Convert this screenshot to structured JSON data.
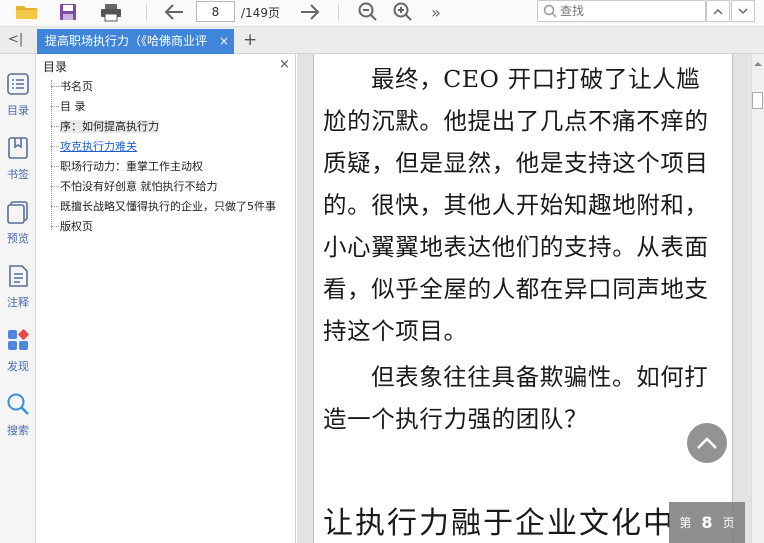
{
  "toolbar": {
    "current_page": "8",
    "total_pages": "/149页",
    "search_placeholder": "查找",
    "more_label": "»"
  },
  "tab": {
    "title": "提高职场执行力（《哈佛商业评",
    "close": "×",
    "new_tab": "+"
  },
  "rail": {
    "collapse": "<|",
    "items": [
      {
        "label": "目录",
        "icon": "toc-icon"
      },
      {
        "label": "书签",
        "icon": "bookmark-icon"
      },
      {
        "label": "预览",
        "icon": "preview-icon"
      },
      {
        "label": "注释",
        "icon": "note-icon"
      },
      {
        "label": "发现",
        "icon": "discover-icon"
      },
      {
        "label": "搜索",
        "icon": "search-icon"
      }
    ]
  },
  "toc": {
    "title": "目录",
    "close": "×",
    "items": [
      {
        "label": "书名页"
      },
      {
        "label": "目 录"
      },
      {
        "label": "序：如何提高执行力",
        "state": "selected"
      },
      {
        "label": "攻克执行力难关",
        "state": "link"
      },
      {
        "label": "职场行动力：重掌工作主动权"
      },
      {
        "label": "不怕没有好创意 就怕执行不给力"
      },
      {
        "label": "既擅长战略又懂得执行的企业，只做了5件事"
      },
      {
        "label": "版权页"
      }
    ]
  },
  "document": {
    "lines": [
      "最终，CEO 开口打破了让人尴",
      "尬的沉默。他提出了几点不痛不痒的",
      "质疑，但是显然，他是支持这个项目",
      "的。很快，其他人开始知趣地附和，",
      "小心翼翼地表达他们的支持。从表面",
      "看，似乎全屋的人都在异口同声地支",
      "持这个项目。",
      "但表象往往具备欺骗性。如何打",
      "造一个执行力强的团队？"
    ],
    "heading": "让执行力融于企业文化中"
  },
  "page_indicator": {
    "prefix": "第",
    "number": "8",
    "suffix": "页"
  },
  "colors": {
    "accent": "#3f86db",
    "rail_label": "#4a6cb5",
    "link": "#1d5fd1"
  }
}
